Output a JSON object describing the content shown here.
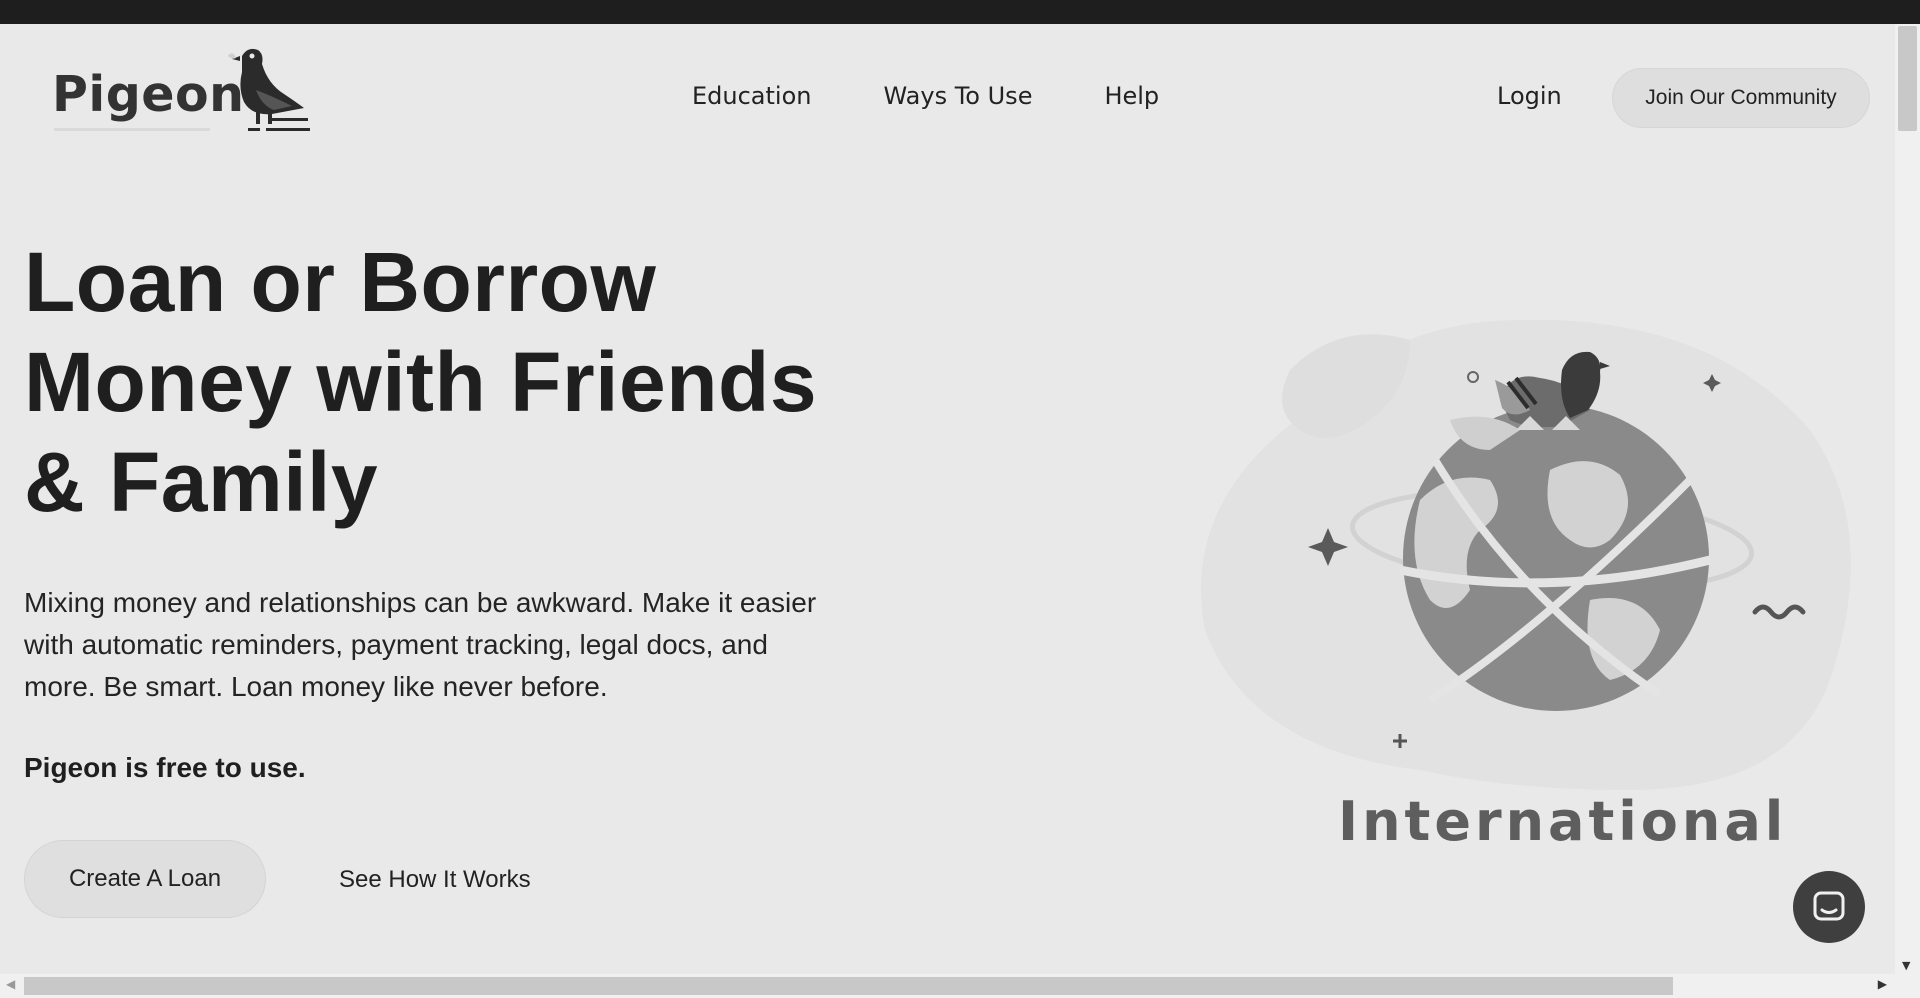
{
  "brand": {
    "name": "Pigeon"
  },
  "nav": {
    "items": [
      {
        "label": "Education"
      },
      {
        "label": "Ways To Use"
      },
      {
        "label": "Help"
      }
    ],
    "login_label": "Login",
    "join_label": "Join Our Community"
  },
  "hero": {
    "title_lines": [
      "Loan or Borrow",
      "Money with Friends",
      "& Family"
    ],
    "description_lines": [
      "Mixing money and relationships can be awkward. Make it easier",
      "with automatic reminders, payment tracking, legal docs, and",
      "more. Be smart. Loan money like never before."
    ],
    "free_note": "Pigeon is free to use.",
    "primary_cta": "Create A Loan",
    "secondary_cta": "See How It Works"
  },
  "illustration": {
    "label": "International",
    "icon": "globe-with-pigeon-illustration"
  },
  "chat": {
    "icon": "chat-bubble-icon"
  },
  "colors": {
    "background": "#e9e9e9",
    "topbar": "#1e1e1e",
    "button_bg": "#dfdfdf",
    "chat_bg": "#3f3f3f"
  }
}
